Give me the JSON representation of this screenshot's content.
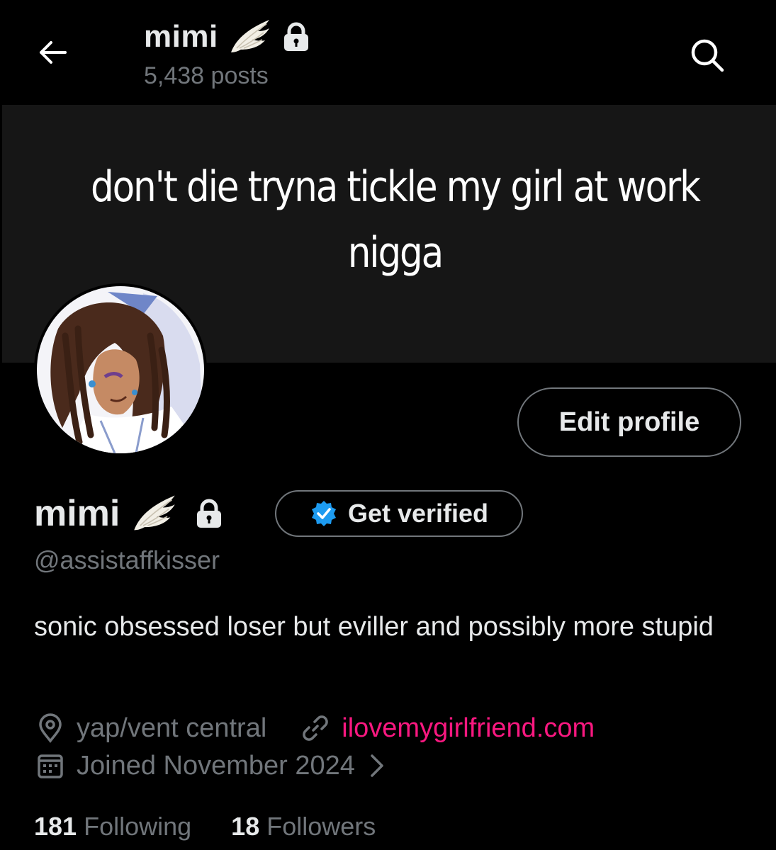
{
  "header": {
    "title": "mimi",
    "posts_count": "5,438 posts",
    "back_icon": "arrow-left-icon",
    "search_icon": "search-icon"
  },
  "banner": {
    "text_line1": "don't die tryna tickle my girl at work",
    "text_line2": "nigga",
    "background": "#161616"
  },
  "profile": {
    "avatar": "illustrated-avatar",
    "edit_profile_label": "Edit profile",
    "display_name": "mimi",
    "name_emoji": "wing-icon",
    "protected_icon": "lock-icon",
    "get_verified_label": "Get verified",
    "handle": "@assistaffkisser",
    "bio": "sonic obsessed loser but eviller and possibly more stupid",
    "location": "yap/vent central",
    "website": "ilovemygirlfriend.com",
    "joined": "Joined November 2024",
    "following_count": "181",
    "following_label": "Following",
    "followers_count": "18",
    "followers_label": "Followers"
  },
  "colors": {
    "background": "#000000",
    "text_primary": "#e7e9ea",
    "text_secondary": "#71767b",
    "link": "#f91880",
    "verified_blue": "#1d9bf0"
  }
}
